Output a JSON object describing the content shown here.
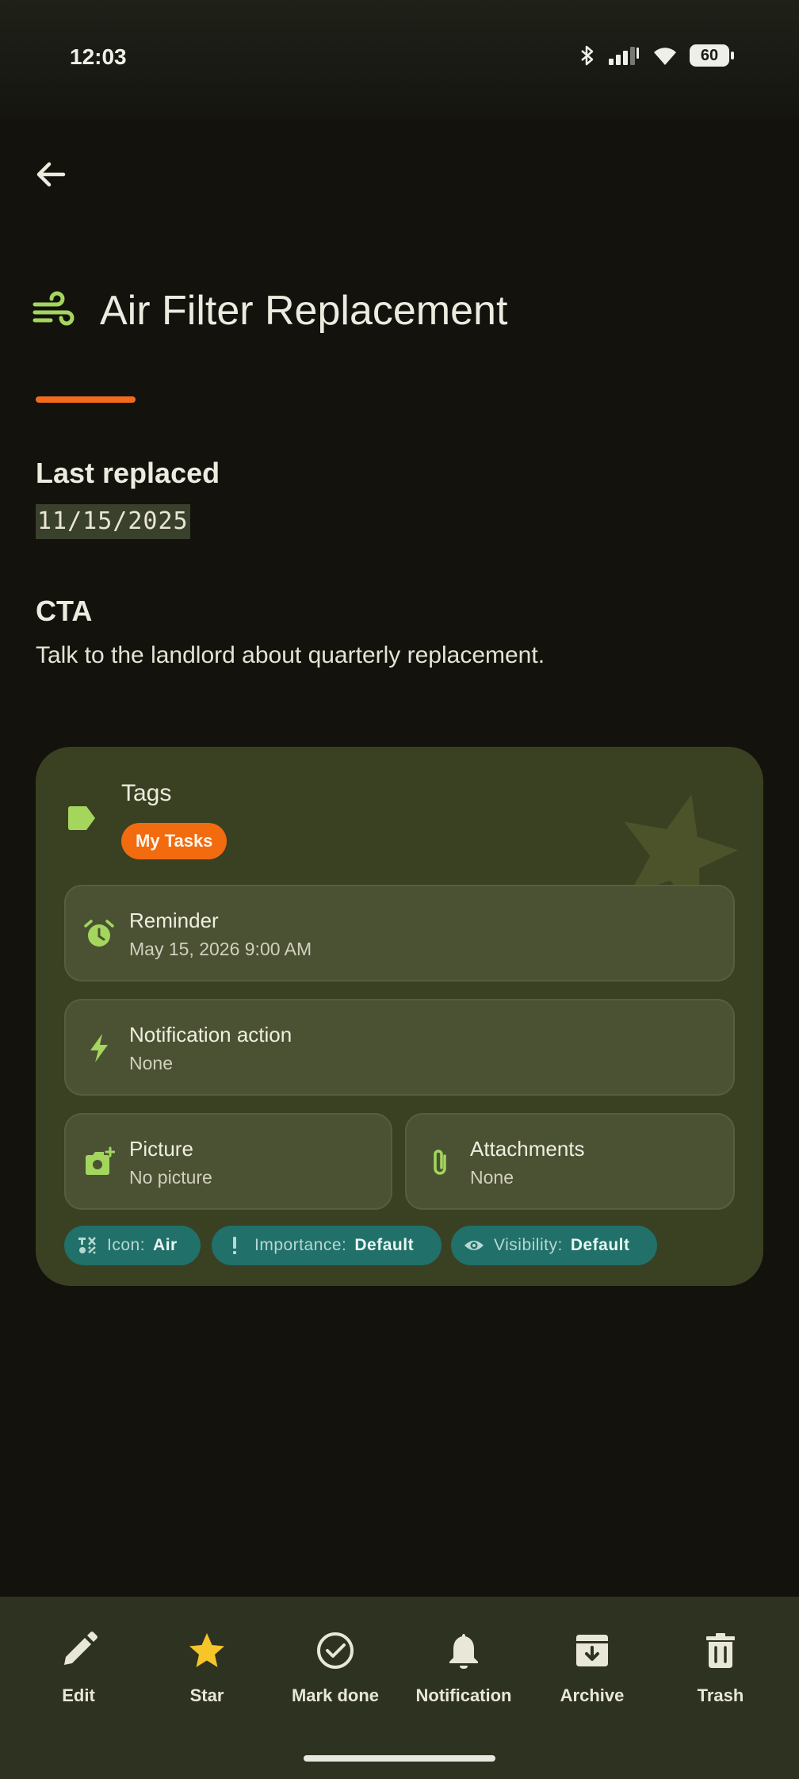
{
  "status_bar": {
    "time": "12:03",
    "battery": "60"
  },
  "task": {
    "title": "Air Filter Replacement",
    "sections": [
      {
        "label": "Last replaced",
        "value": "11/15/2025"
      },
      {
        "label": "CTA",
        "value": "Talk to the landlord about quarterly replacement."
      }
    ]
  },
  "card": {
    "tags_label": "Tags",
    "tag": "My Tasks",
    "reminder": {
      "title": "Reminder",
      "value": "May 15, 2026 9:00 AM"
    },
    "notification_action": {
      "title": "Notification action",
      "value": "None"
    },
    "picture": {
      "title": "Picture",
      "value": "No picture"
    },
    "attachments": {
      "title": "Attachments",
      "value": "None"
    },
    "chips": [
      {
        "key": "Icon:",
        "value": "Air"
      },
      {
        "key": "Importance:",
        "value": "Default"
      },
      {
        "key": "Visibility:",
        "value": "Default"
      }
    ]
  },
  "bottom_actions": [
    {
      "label": "Edit",
      "icon": "pencil-icon"
    },
    {
      "label": "Star",
      "icon": "star-icon"
    },
    {
      "label": "Mark done",
      "icon": "check-circle-icon"
    },
    {
      "label": "Notification",
      "icon": "bell-icon"
    },
    {
      "label": "Archive",
      "icon": "archive-icon"
    },
    {
      "label": "Trash",
      "icon": "trash-icon"
    }
  ],
  "colors": {
    "accent_orange": "#f26b1d",
    "lime_green": "#a4d65e",
    "card_bg": "#3a4022",
    "chip_teal": "#21706a"
  }
}
